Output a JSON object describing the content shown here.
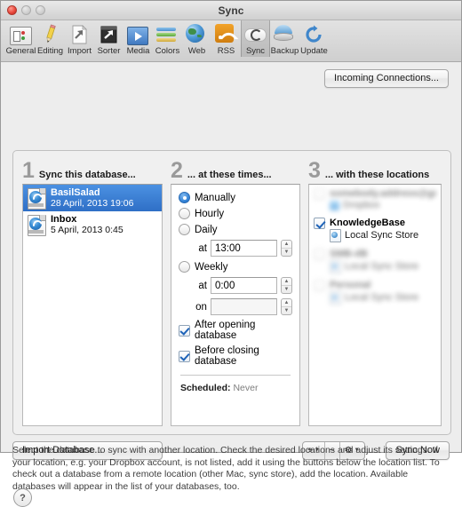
{
  "window": {
    "title": "Sync",
    "traffic_lights": [
      "close",
      "minimize",
      "zoom"
    ]
  },
  "toolbar": {
    "items": [
      {
        "label": "General",
        "icon": "general-icon",
        "selected": false
      },
      {
        "label": "Editing",
        "icon": "pencil-icon",
        "selected": false
      },
      {
        "label": "Import",
        "icon": "import-icon",
        "selected": false
      },
      {
        "label": "Sorter",
        "icon": "sorter-icon",
        "selected": false
      },
      {
        "label": "Media",
        "icon": "media-play-icon",
        "selected": false
      },
      {
        "label": "Colors",
        "icon": "colors-icon",
        "selected": false
      },
      {
        "label": "Web",
        "icon": "globe-icon",
        "selected": false
      },
      {
        "label": "RSS",
        "icon": "rss-icon",
        "selected": false
      },
      {
        "label": "Sync",
        "icon": "sync-cloud-icon",
        "selected": true
      },
      {
        "label": "Backup",
        "icon": "backup-icon",
        "selected": false
      },
      {
        "label": "Update",
        "icon": "update-refresh-icon",
        "selected": false
      }
    ]
  },
  "incoming_connections_button": "Incoming Connections...",
  "steps": {
    "one": {
      "number": "1",
      "text": "Sync this database..."
    },
    "two": {
      "number": "2",
      "text": "... at these times..."
    },
    "three": {
      "number": "3",
      "text": "... with these locations"
    }
  },
  "databases": [
    {
      "name": "BasilSalad",
      "date": "28 April, 2013 19:06",
      "selected": true
    },
    {
      "name": "Inbox",
      "date": "5 April, 2013 0:45",
      "selected": false
    }
  ],
  "schedule": {
    "options": [
      {
        "label": "Manually",
        "selected": true
      },
      {
        "label": "Hourly",
        "selected": false
      },
      {
        "label": "Daily",
        "selected": false
      },
      {
        "label": "Weekly",
        "selected": false
      }
    ],
    "daily_at_label": "at",
    "daily_at_value": "13:00",
    "weekly_at_label": "at",
    "weekly_at_value": "0:00",
    "weekly_on_label": "on",
    "weekly_on_value": "",
    "checkboxes": [
      {
        "label": "After opening database",
        "checked": true
      },
      {
        "label": "Before closing database",
        "checked": true
      }
    ],
    "scheduled_label": "Scheduled:",
    "scheduled_value": "Never"
  },
  "locations": [
    {
      "name": "",
      "sub": "",
      "checked": false,
      "blurred": true,
      "sub_icon": "dropbox-icon"
    },
    {
      "name": "KnowledgeBase",
      "sub": "Local Sync Store",
      "checked": true,
      "blurred": false,
      "sub_icon": "sync-store-icon"
    },
    {
      "name": "",
      "sub": "",
      "checked": false,
      "blurred": true,
      "sub_icon": "sync-store-icon"
    },
    {
      "name": "",
      "sub": "",
      "checked": false,
      "blurred": true,
      "sub_icon": "sync-store-icon"
    }
  ],
  "buttons": {
    "import_database": "Import Database...",
    "sync_now": "Sync Now",
    "add": "+",
    "remove": "−",
    "action": "⚙"
  },
  "footer_text": "Select the database to sync with another location. Check the desired locations and adjust its settings. If your location, e.g. your Dropbox account, is not listed, add it using the buttons below the location list. To check out a database from a remote location (other Mac, sync store), add the location. Available databases will appear in the list of your databases, too.",
  "help_button": "?",
  "colors": {
    "selection_blue": "#2f6fc6",
    "window_bg": "#ededed",
    "rss_orange": "#cf7d10"
  }
}
